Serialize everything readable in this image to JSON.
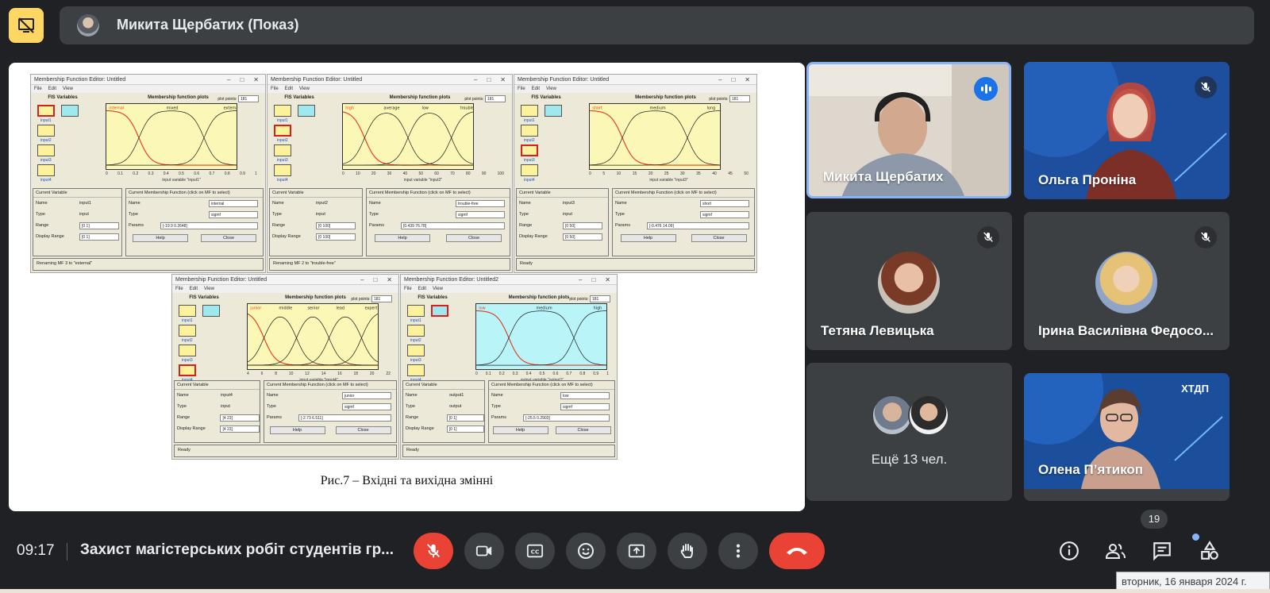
{
  "presenter": {
    "name": "Микита Щербатих (Показ)"
  },
  "slide": {
    "caption": "Рис.7 – Вхідні та вихідна змінні",
    "windows": [
      {
        "title": "Membership Function Editor: Untitled",
        "menu": [
          "File",
          "Edit",
          "View"
        ],
        "plot_title": "Membership function plots",
        "plot_points_label": "plot points:",
        "plot_points": "181",
        "mf_labels": [
          "internal",
          "mixed",
          "external"
        ],
        "axis": [
          "0",
          "0.1",
          "0.2",
          "0.3",
          "0.4",
          "0.5",
          "0.6",
          "0.7",
          "0.8",
          "0.9",
          "1"
        ],
        "axis_label": "input variable \"input1\"",
        "fis_label": "FIS Variables",
        "inputs": [
          "input1",
          "input2",
          "input3",
          "input4"
        ],
        "output": "output1",
        "cur_var": "Current Variable",
        "var_name": "input1",
        "var_type": "input",
        "range": "[0 1]",
        "display_range": "[0 1]",
        "cur_mf": "Current Membership Function (click on MF to select)",
        "mf_name": "internal",
        "mf_type": "sigmf",
        "params": "[-19.9 0.2648]",
        "help": "Help",
        "close": "Close",
        "status": "Renaming MF 3 to \"external\""
      },
      {
        "title": "Membership Function Editor: Untitled",
        "menu": [
          "File",
          "Edit",
          "View"
        ],
        "plot_title": "Membership function plots",
        "plot_points_label": "plot points:",
        "plot_points": "181",
        "mf_labels": [
          "high",
          "average",
          "low",
          "trouble-free"
        ],
        "axis": [
          "0",
          "10",
          "20",
          "30",
          "40",
          "50",
          "60",
          "70",
          "80",
          "90",
          "100"
        ],
        "axis_label": "input variable \"input2\"",
        "fis_label": "FIS Variables",
        "inputs": [
          "input1",
          "input2",
          "input3",
          "input4"
        ],
        "output": "output1",
        "cur_var": "Current Variable",
        "var_name": "input2",
        "var_type": "input",
        "range": "[0 100]",
        "display_range": "[0 100]",
        "cur_mf": "Current Membership Function (click on MF to select)",
        "mf_name": "trouble-free",
        "mf_type": "sigmf",
        "params": "[0.439 76.78]",
        "help": "Help",
        "close": "Close",
        "status": "Renaming MF 2 to \"trouble-free\""
      },
      {
        "title": "Membership Function Editor: Untitled",
        "menu": [
          "File",
          "Edit",
          "View"
        ],
        "plot_title": "Membership function plots",
        "plot_points_label": "plot points:",
        "plot_points": "181",
        "mf_labels": [
          "short",
          "medium",
          "long"
        ],
        "axis": [
          "0",
          "5",
          "10",
          "15",
          "20",
          "25",
          "30",
          "35",
          "40",
          "45",
          "50"
        ],
        "axis_label": "input variable \"input3\"",
        "fis_label": "FIS Variables",
        "inputs": [
          "input1",
          "input2",
          "input3",
          "input4"
        ],
        "output": "output1",
        "cur_var": "Current Variable",
        "var_name": "input3",
        "var_type": "input",
        "range": "[0 50]",
        "display_range": "[0 50]",
        "cur_mf": "Current Membership Function (click on MF to select)",
        "mf_name": "short",
        "mf_type": "sigmf",
        "params": "[-0.476 14.09]",
        "help": "Help",
        "close": "Close",
        "status": "Ready"
      },
      {
        "title": "Membership Function Editor: Untitled",
        "menu": [
          "File",
          "Edit",
          "View"
        ],
        "plot_title": "Membership function plots",
        "plot_points_label": "plot points:",
        "plot_points": "181",
        "mf_labels": [
          "junior",
          "middle",
          "senior",
          "lead",
          "expert"
        ],
        "axis": [
          "4",
          "6",
          "8",
          "10",
          "12",
          "14",
          "16",
          "18",
          "20",
          "22"
        ],
        "axis_label": "input variable \"input4\"",
        "fis_label": "FIS Variables",
        "inputs": [
          "input1",
          "input2",
          "input3",
          "input4"
        ],
        "output": "output1",
        "cur_var": "Current Variable",
        "var_name": "input4",
        "var_type": "input",
        "range": "[4 23]",
        "display_range": "[4 23]",
        "cur_mf": "Current Membership Function (click on MF to select)",
        "mf_name": "junior",
        "mf_type": "sigmf",
        "params": "[-2.73 6.511]",
        "help": "Help",
        "close": "Close",
        "status": "Ready"
      },
      {
        "title": "Membership Function Editor: Untitled2",
        "menu": [
          "File",
          "Edit",
          "View"
        ],
        "plot_title": "Membership function plots",
        "plot_points_label": "plot points:",
        "plot_points": "181",
        "mf_labels": [
          "low",
          "medium",
          "high"
        ],
        "axis": [
          "0",
          "0.1",
          "0.2",
          "0.3",
          "0.4",
          "0.5",
          "0.6",
          "0.7",
          "0.8",
          "0.9",
          "1"
        ],
        "axis_label": "output variable \"output1\"",
        "fis_label": "FIS Variables",
        "inputs": [
          "input1",
          "input2",
          "input3",
          "input4"
        ],
        "output": "output1",
        "cur_var": "Current Variable",
        "var_name": "output1",
        "var_type": "output",
        "range": "[0 1]",
        "display_range": "[0 1]",
        "cur_mf": "Current Membership Function (click on MF to select)",
        "mf_name": "low",
        "mf_type": "sigmf",
        "params": "[-25.5 0.2903]",
        "help": "Help",
        "close": "Close",
        "status": "Ready"
      }
    ]
  },
  "participants": {
    "p1": {
      "name": "Микита Щербатих",
      "status_icon": "speaking-icon"
    },
    "p2": {
      "name": "Ольга Проніна",
      "status_icon": "mic-off-icon"
    },
    "p3": {
      "name": "Тетяна Левицька",
      "status_icon": "mic-off-icon"
    },
    "p4": {
      "name": "Ірина Василівна Федосо...",
      "status_icon": "mic-off-icon"
    },
    "more": {
      "label": "Ещё 13 чел."
    },
    "p5": {
      "name": "Олена П’ятикоп",
      "tile_logo": "ХТДП"
    }
  },
  "bottom_bar": {
    "time": "09:17",
    "meeting_title": "Захист магістерських робіт студентів гр...",
    "participant_count": "19",
    "tooltip": "вторник, 16 января 2024 г."
  },
  "colors": {
    "accent": "#fdd663",
    "danger": "#ea4335",
    "speaking": "#1a73e8",
    "tile": "#3c4043",
    "bg": "#202124"
  }
}
